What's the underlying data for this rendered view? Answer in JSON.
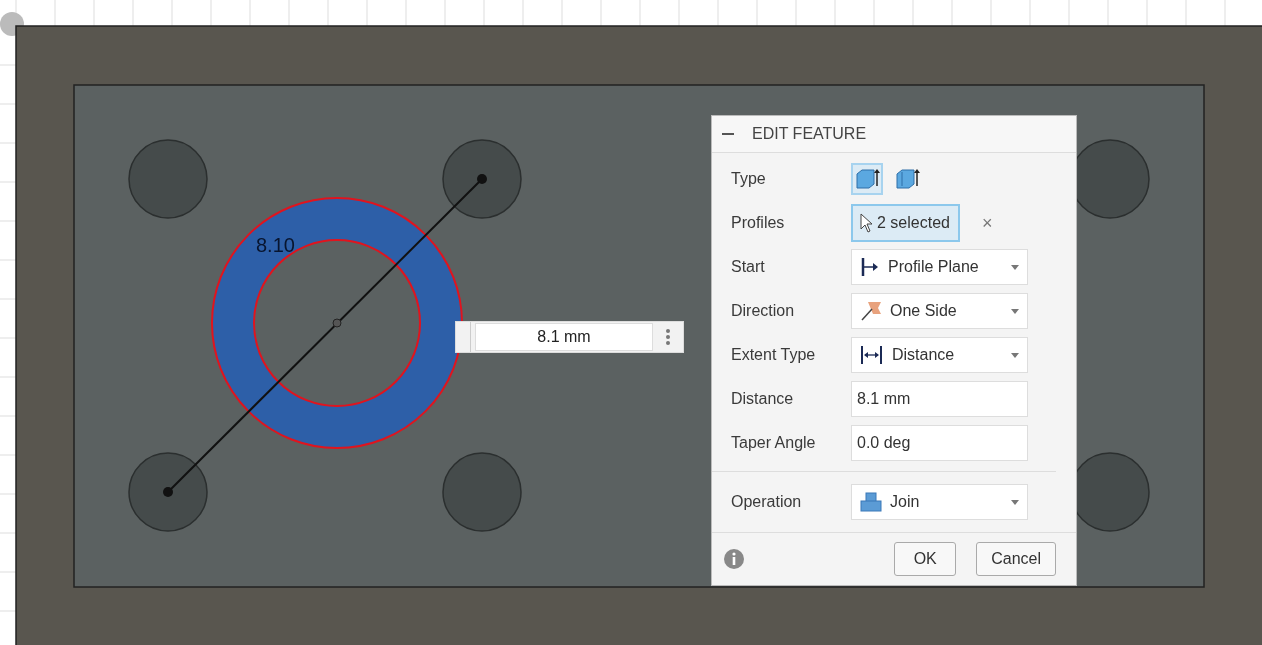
{
  "viewport": {
    "dimension_label": "8.10",
    "dimension_input": {
      "value": "8.1 mm"
    }
  },
  "dialog": {
    "title": "EDIT FEATURE",
    "rows": [
      {
        "kind": "type",
        "label": "Type",
        "options": [
          {
            "selected": true
          },
          {
            "selected": false
          }
        ]
      },
      {
        "kind": "selection",
        "label": "Profiles",
        "value": "2 selected",
        "clear": "×"
      },
      {
        "kind": "dropdown",
        "label": "Start",
        "value": "Profile Plane"
      },
      {
        "kind": "dropdown",
        "label": "Direction",
        "value": "One Side"
      },
      {
        "kind": "dropdown",
        "label": "Extent Type",
        "value": "Distance"
      },
      {
        "kind": "text",
        "label": "Distance",
        "value": "8.1 mm"
      },
      {
        "kind": "text",
        "label": "Taper Angle",
        "value": "0.0 deg"
      },
      {
        "kind": "separator"
      },
      {
        "kind": "dropdown",
        "label": "Operation",
        "value": "Join"
      }
    ],
    "buttons": [
      "OK",
      "Cancel"
    ]
  }
}
